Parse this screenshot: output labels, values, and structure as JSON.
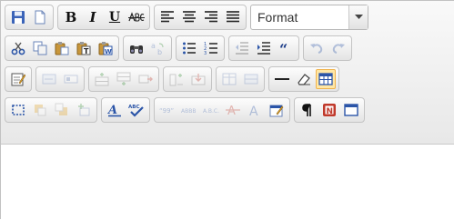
{
  "toolbar": {
    "bold_label": "B",
    "italic_label": "I",
    "underline_label": "U",
    "format_combo": {
      "value": "Format"
    }
  },
  "colors": {
    "accent_highlight": "#ffe7a5",
    "toolbar_bg": "#ececec",
    "border": "#c4c4c4"
  }
}
